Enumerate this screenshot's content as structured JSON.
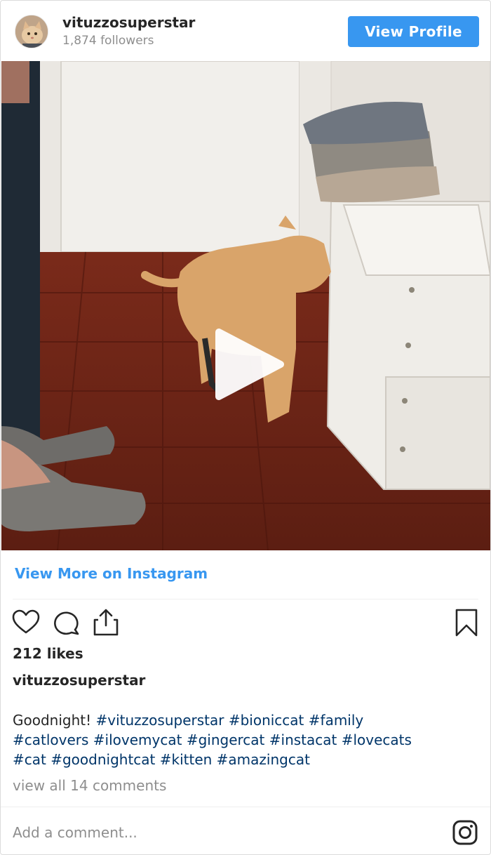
{
  "header": {
    "username": "vituzzosuperstar",
    "followers": "1,874 followers",
    "view_profile_label": "View Profile"
  },
  "media": {
    "type": "video",
    "play_icon": "play-icon"
  },
  "view_more_label": "View More on Instagram",
  "actions": {
    "icons": [
      "heart-icon",
      "comment-icon",
      "share-icon",
      "bookmark-icon"
    ]
  },
  "likes": "212 likes",
  "caption": {
    "username": "vituzzosuperstar",
    "text": "Goodnight!",
    "hashtags": [
      "#vituzzosuperstar",
      "#bioniccat",
      "#family",
      "#catlovers",
      "#ilovemycat",
      "#gingercat",
      "#instacat",
      "#lovecats",
      "#cat",
      "#goodnightcat",
      "#kitten",
      "#amazingcat"
    ]
  },
  "comments_link": "view all 14 comments",
  "comment_box": {
    "placeholder": "Add a comment...",
    "logo_icon": "instagram-logo-icon"
  },
  "colors": {
    "accent": "#3897f0",
    "hashtag": "#003569",
    "muted": "#8e8e8e",
    "text": "#262626"
  }
}
